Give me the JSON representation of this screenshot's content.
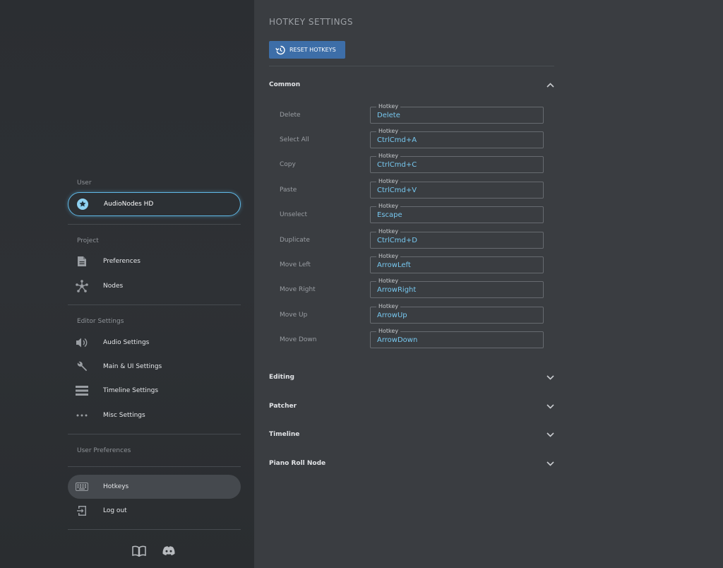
{
  "sidebar": {
    "user_section": "User",
    "user_item": "AudioNodes HD",
    "project_section": "Project",
    "project_items": [
      "Preferences",
      "Nodes"
    ],
    "editor_section": "Editor Settings",
    "editor_items": [
      "Audio Settings",
      "Main & UI Settings",
      "Timeline Settings",
      "Misc Settings"
    ],
    "user_prefs_section": "User Preferences",
    "bottom_items": [
      "Hotkeys",
      "Log out"
    ],
    "footer_icons": [
      "book-icon",
      "discord-icon"
    ]
  },
  "main": {
    "title": "HOTKEY SETTINGS",
    "reset_label": "RESET HOTKEYS",
    "sections": [
      "Common",
      "Editing",
      "Patcher",
      "Timeline",
      "Piano Roll Node"
    ],
    "field_legend": "Hotkey",
    "hotkeys": [
      {
        "label": "Delete",
        "value": "Delete"
      },
      {
        "label": "Select All",
        "value": "CtrlCmd+A"
      },
      {
        "label": "Copy",
        "value": "CtrlCmd+C"
      },
      {
        "label": "Paste",
        "value": "CtrlCmd+V"
      },
      {
        "label": "Unselect",
        "value": "Escape"
      },
      {
        "label": "Duplicate",
        "value": "CtrlCmd+D"
      },
      {
        "label": "Move Left",
        "value": "ArrowLeft"
      },
      {
        "label": "Move Right",
        "value": "ArrowRight"
      },
      {
        "label": "Move Up",
        "value": "ArrowUp"
      },
      {
        "label": "Move Down",
        "value": "ArrowDown"
      }
    ]
  },
  "colors": {
    "accent": "#5fb8e6",
    "button": "#3d6ea8",
    "hotkey_value": "#77c8f0"
  }
}
